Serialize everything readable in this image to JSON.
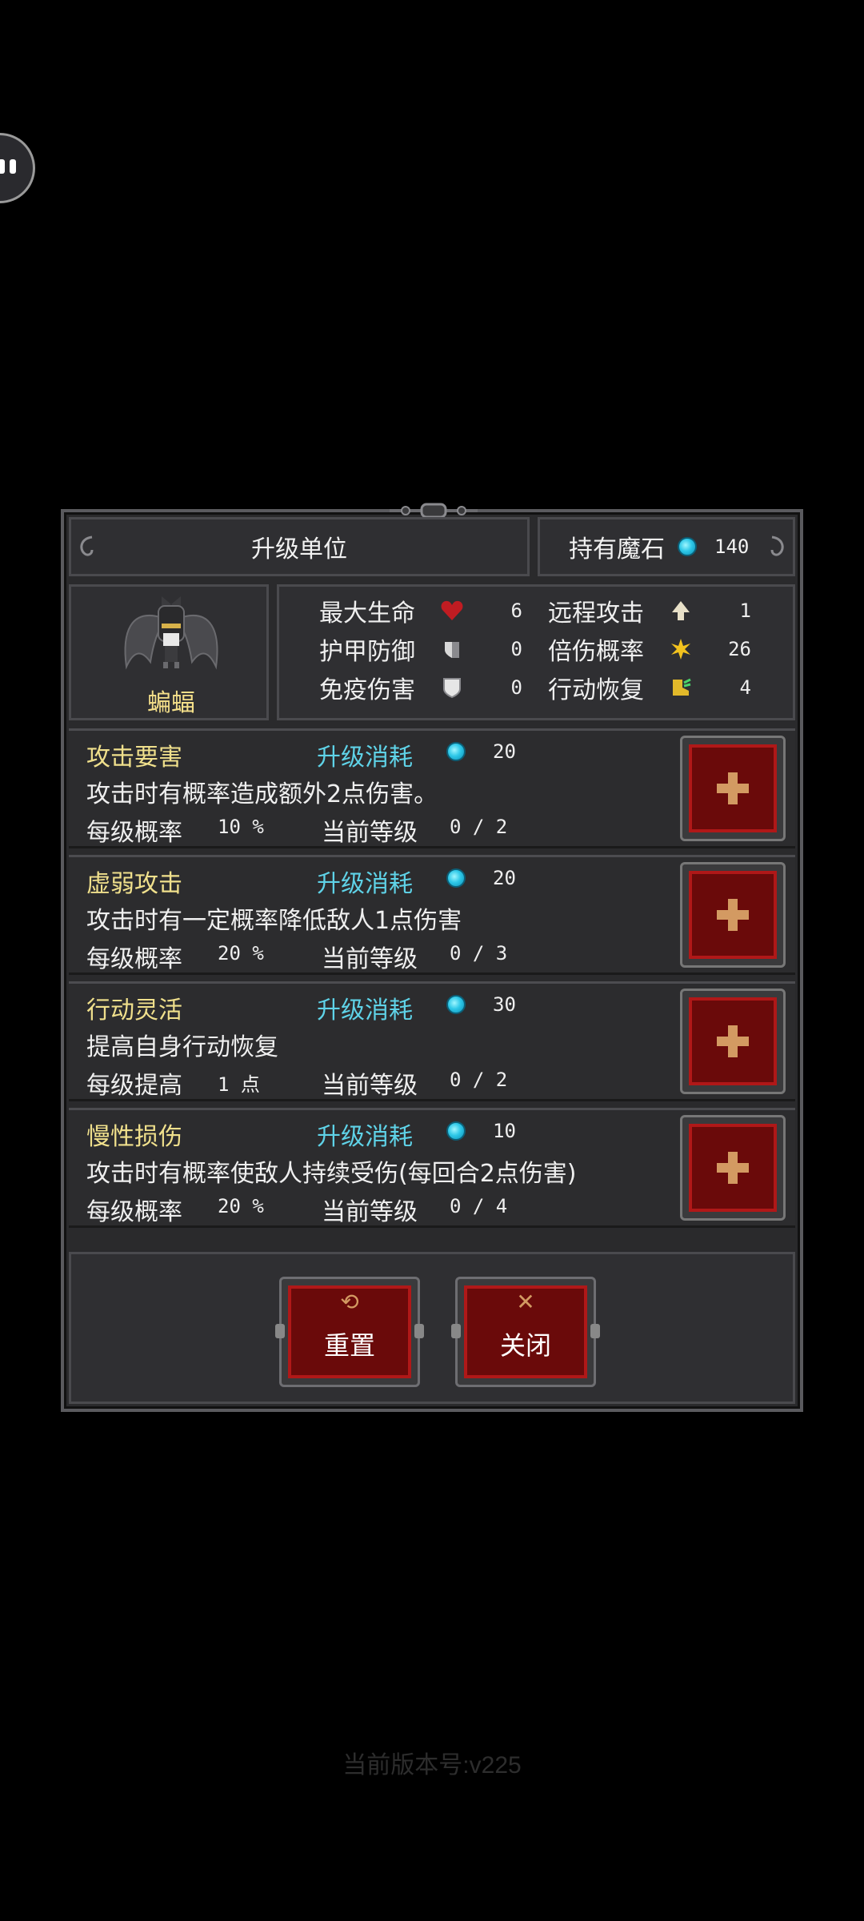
{
  "header": {
    "title": "升级单位",
    "stones_label": "持有魔石",
    "stones_value": "140"
  },
  "unit": {
    "name": "蝙蝠",
    "stats": {
      "max_hp_label": "最大生命",
      "max_hp": "6",
      "armor_label": "护甲防御",
      "armor": "0",
      "immune_label": "免疫伤害",
      "immune": "0",
      "ranged_label": "远程攻击",
      "ranged": "1",
      "crit_label": "倍伤概率",
      "crit": "26",
      "recover_label": "行动恢复",
      "recover": "4"
    }
  },
  "skills": [
    {
      "name": "攻击要害",
      "cost_label": "升级消耗",
      "cost": "20",
      "desc": "攻击时有概率造成额外2点伤害。",
      "rate_label": "每级概率",
      "rate": "10 %",
      "level_label": "当前等级",
      "level": "0 / 2"
    },
    {
      "name": "虚弱攻击",
      "cost_label": "升级消耗",
      "cost": "20",
      "desc": "攻击时有一定概率降低敌人1点伤害",
      "rate_label": "每级概率",
      "rate": "20 %",
      "level_label": "当前等级",
      "level": "0 / 3"
    },
    {
      "name": "行动灵活",
      "cost_label": "升级消耗",
      "cost": "30",
      "desc": "提高自身行动恢复",
      "rate_label": "每级提高",
      "rate": "1 点",
      "level_label": "当前等级",
      "level": "0 / 2"
    },
    {
      "name": "慢性损伤",
      "cost_label": "升级消耗",
      "cost": "10",
      "desc": "攻击时有概率使敌人持续受伤(每回合2点伤害)",
      "rate_label": "每级概率",
      "rate": "20 %",
      "level_label": "当前等级",
      "level": "0 / 4"
    }
  ],
  "actions": {
    "reset_label": "重置",
    "close_label": "关闭"
  },
  "footer": {
    "version": "当前版本号:v225"
  },
  "colors": {
    "accent_red": "#b01818",
    "gem_cyan": "#2ec8e8",
    "skill_name_yellow": "#f0e08c",
    "cost_label_cyan": "#5fd3e8"
  },
  "icons": [
    "heart-icon",
    "armor-icon",
    "shield-icon",
    "arrow-up-icon",
    "star-burst-icon",
    "boot-icon",
    "magic-stone-icon",
    "plus-icon",
    "refresh-icon",
    "close-x-icon"
  ]
}
